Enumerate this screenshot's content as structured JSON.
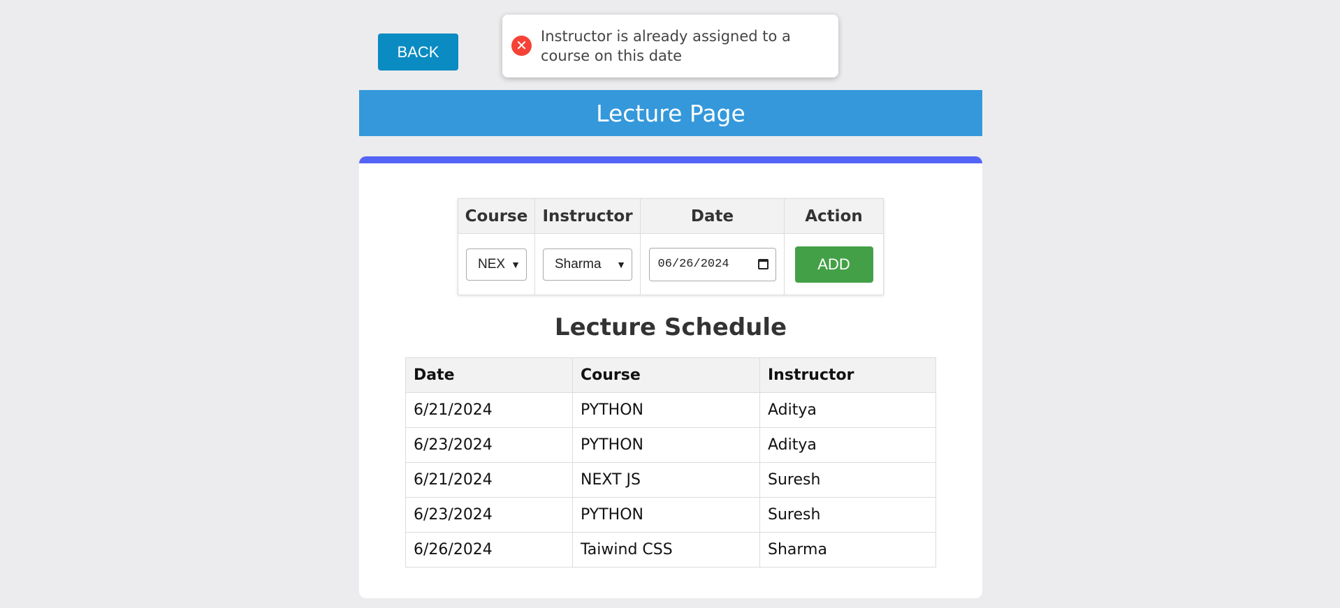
{
  "back_button": {
    "label": "BACK"
  },
  "toast": {
    "message": "Instructor is already assigned to a course on this date",
    "icon": "error-icon",
    "icon_color": "#f44336"
  },
  "header": {
    "title": "Lecture Page",
    "color": "#3498db"
  },
  "card": {
    "accent_color": "#5364f7"
  },
  "form": {
    "headers": [
      "Course",
      "Instructor",
      "Date",
      "Action"
    ],
    "course_value": "NEXT JS",
    "course_visible": "NEX",
    "instructor_value": "Sharma",
    "date_value": "06/26/2024",
    "add_label": "ADD",
    "add_color": "#43a047"
  },
  "schedule": {
    "title": "Lecture Schedule",
    "headers": [
      "Date",
      "Course",
      "Instructor"
    ],
    "rows": [
      [
        "6/21/2024",
        "PYTHON",
        "Aditya"
      ],
      [
        "6/23/2024",
        "PYTHON",
        "Aditya"
      ],
      [
        "6/21/2024",
        "NEXT JS",
        "Suresh"
      ],
      [
        "6/23/2024",
        "PYTHON",
        "Suresh"
      ],
      [
        "6/26/2024",
        "Taiwind CSS",
        "Sharma"
      ]
    ]
  }
}
